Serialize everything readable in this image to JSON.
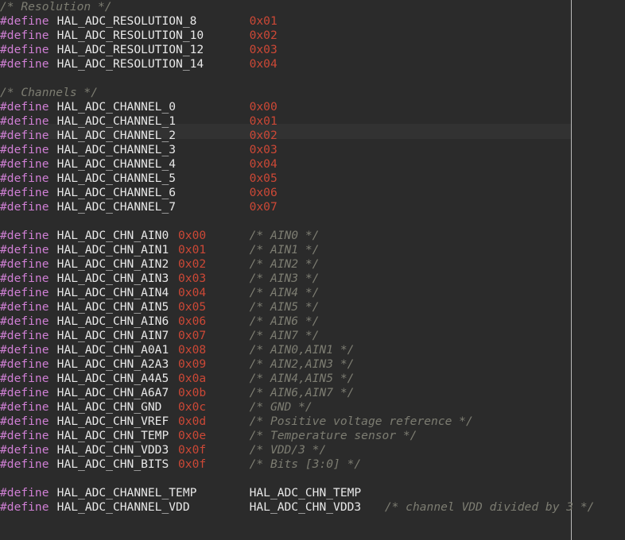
{
  "editor": {
    "language": "C",
    "font_char_width": 8.96,
    "line_height": 18,
    "colors": {
      "background": "#2b2b2b",
      "current_line": "#323232",
      "margin_ruler": "#b9b9b9",
      "directive": "#cf7fd4",
      "identifier": "#e8e8e8",
      "number": "#cc4836",
      "comment": "#7d7d72"
    },
    "margin_column": 80,
    "highlighted_line_index": 9
  },
  "lines": [
    {
      "index": 0,
      "tokens": [
        {
          "col": 0,
          "type": "comment",
          "text": "/* Resolution */"
        }
      ]
    },
    {
      "index": 1,
      "tokens": [
        {
          "col": 0,
          "type": "directive",
          "text": "#define"
        },
        {
          "col": 8,
          "type": "ident",
          "text": "HAL_ADC_RESOLUTION_8"
        },
        {
          "col": 35,
          "type": "number",
          "text": "0x01"
        }
      ]
    },
    {
      "index": 2,
      "tokens": [
        {
          "col": 0,
          "type": "directive",
          "text": "#define"
        },
        {
          "col": 8,
          "type": "ident",
          "text": "HAL_ADC_RESOLUTION_10"
        },
        {
          "col": 35,
          "type": "number",
          "text": "0x02"
        }
      ]
    },
    {
      "index": 3,
      "tokens": [
        {
          "col": 0,
          "type": "directive",
          "text": "#define"
        },
        {
          "col": 8,
          "type": "ident",
          "text": "HAL_ADC_RESOLUTION_12"
        },
        {
          "col": 35,
          "type": "number",
          "text": "0x03"
        }
      ]
    },
    {
      "index": 4,
      "tokens": [
        {
          "col": 0,
          "type": "directive",
          "text": "#define"
        },
        {
          "col": 8,
          "type": "ident",
          "text": "HAL_ADC_RESOLUTION_14"
        },
        {
          "col": 35,
          "type": "number",
          "text": "0x04"
        }
      ]
    },
    {
      "index": 5,
      "tokens": []
    },
    {
      "index": 6,
      "tokens": [
        {
          "col": 0,
          "type": "comment",
          "text": "/* Channels */"
        }
      ]
    },
    {
      "index": 7,
      "tokens": [
        {
          "col": 0,
          "type": "directive",
          "text": "#define"
        },
        {
          "col": 8,
          "type": "ident",
          "text": "HAL_ADC_CHANNEL_0"
        },
        {
          "col": 35,
          "type": "number",
          "text": "0x00"
        }
      ]
    },
    {
      "index": 8,
      "tokens": [
        {
          "col": 0,
          "type": "directive",
          "text": "#define"
        },
        {
          "col": 8,
          "type": "ident",
          "text": "HAL_ADC_CHANNEL_1"
        },
        {
          "col": 35,
          "type": "number",
          "text": "0x01"
        }
      ]
    },
    {
      "index": 9,
      "tokens": [
        {
          "col": 0,
          "type": "directive",
          "text": "#define"
        },
        {
          "col": 8,
          "type": "ident",
          "text": "HAL_ADC_CHANNEL_2"
        },
        {
          "col": 35,
          "type": "number",
          "text": "0x02"
        }
      ]
    },
    {
      "index": 10,
      "tokens": [
        {
          "col": 0,
          "type": "directive",
          "text": "#define"
        },
        {
          "col": 8,
          "type": "ident",
          "text": "HAL_ADC_CHANNEL_3"
        },
        {
          "col": 35,
          "type": "number",
          "text": "0x03"
        }
      ]
    },
    {
      "index": 11,
      "tokens": [
        {
          "col": 0,
          "type": "directive",
          "text": "#define"
        },
        {
          "col": 8,
          "type": "ident",
          "text": "HAL_ADC_CHANNEL_4"
        },
        {
          "col": 35,
          "type": "number",
          "text": "0x04"
        }
      ]
    },
    {
      "index": 12,
      "tokens": [
        {
          "col": 0,
          "type": "directive",
          "text": "#define"
        },
        {
          "col": 8,
          "type": "ident",
          "text": "HAL_ADC_CHANNEL_5"
        },
        {
          "col": 35,
          "type": "number",
          "text": "0x05"
        }
      ]
    },
    {
      "index": 13,
      "tokens": [
        {
          "col": 0,
          "type": "directive",
          "text": "#define"
        },
        {
          "col": 8,
          "type": "ident",
          "text": "HAL_ADC_CHANNEL_6"
        },
        {
          "col": 35,
          "type": "number",
          "text": "0x06"
        }
      ]
    },
    {
      "index": 14,
      "tokens": [
        {
          "col": 0,
          "type": "directive",
          "text": "#define"
        },
        {
          "col": 8,
          "type": "ident",
          "text": "HAL_ADC_CHANNEL_7"
        },
        {
          "col": 35,
          "type": "number",
          "text": "0x07"
        }
      ]
    },
    {
      "index": 15,
      "tokens": []
    },
    {
      "index": 16,
      "tokens": [
        {
          "col": 0,
          "type": "directive",
          "text": "#define"
        },
        {
          "col": 8,
          "type": "ident",
          "text": "HAL_ADC_CHN_AIN0"
        },
        {
          "col": 25,
          "type": "number",
          "text": "0x00"
        },
        {
          "col": 35,
          "type": "comment",
          "text": "/* AIN0 */"
        }
      ]
    },
    {
      "index": 17,
      "tokens": [
        {
          "col": 0,
          "type": "directive",
          "text": "#define"
        },
        {
          "col": 8,
          "type": "ident",
          "text": "HAL_ADC_CHN_AIN1"
        },
        {
          "col": 25,
          "type": "number",
          "text": "0x01"
        },
        {
          "col": 35,
          "type": "comment",
          "text": "/* AIN1 */"
        }
      ]
    },
    {
      "index": 18,
      "tokens": [
        {
          "col": 0,
          "type": "directive",
          "text": "#define"
        },
        {
          "col": 8,
          "type": "ident",
          "text": "HAL_ADC_CHN_AIN2"
        },
        {
          "col": 25,
          "type": "number",
          "text": "0x02"
        },
        {
          "col": 35,
          "type": "comment",
          "text": "/* AIN2 */"
        }
      ]
    },
    {
      "index": 19,
      "tokens": [
        {
          "col": 0,
          "type": "directive",
          "text": "#define"
        },
        {
          "col": 8,
          "type": "ident",
          "text": "HAL_ADC_CHN_AIN3"
        },
        {
          "col": 25,
          "type": "number",
          "text": "0x03"
        },
        {
          "col": 35,
          "type": "comment",
          "text": "/* AIN3 */"
        }
      ]
    },
    {
      "index": 20,
      "tokens": [
        {
          "col": 0,
          "type": "directive",
          "text": "#define"
        },
        {
          "col": 8,
          "type": "ident",
          "text": "HAL_ADC_CHN_AIN4"
        },
        {
          "col": 25,
          "type": "number",
          "text": "0x04"
        },
        {
          "col": 35,
          "type": "comment",
          "text": "/* AIN4 */"
        }
      ]
    },
    {
      "index": 21,
      "tokens": [
        {
          "col": 0,
          "type": "directive",
          "text": "#define"
        },
        {
          "col": 8,
          "type": "ident",
          "text": "HAL_ADC_CHN_AIN5"
        },
        {
          "col": 25,
          "type": "number",
          "text": "0x05"
        },
        {
          "col": 35,
          "type": "comment",
          "text": "/* AIN5 */"
        }
      ]
    },
    {
      "index": 22,
      "tokens": [
        {
          "col": 0,
          "type": "directive",
          "text": "#define"
        },
        {
          "col": 8,
          "type": "ident",
          "text": "HAL_ADC_CHN_AIN6"
        },
        {
          "col": 25,
          "type": "number",
          "text": "0x06"
        },
        {
          "col": 35,
          "type": "comment",
          "text": "/* AIN6 */"
        }
      ]
    },
    {
      "index": 23,
      "tokens": [
        {
          "col": 0,
          "type": "directive",
          "text": "#define"
        },
        {
          "col": 8,
          "type": "ident",
          "text": "HAL_ADC_CHN_AIN7"
        },
        {
          "col": 25,
          "type": "number",
          "text": "0x07"
        },
        {
          "col": 35,
          "type": "comment",
          "text": "/* AIN7 */"
        }
      ]
    },
    {
      "index": 24,
      "tokens": [
        {
          "col": 0,
          "type": "directive",
          "text": "#define"
        },
        {
          "col": 8,
          "type": "ident",
          "text": "HAL_ADC_CHN_A0A1"
        },
        {
          "col": 25,
          "type": "number",
          "text": "0x08"
        },
        {
          "col": 35,
          "type": "comment",
          "text": "/* AIN0,AIN1 */"
        }
      ]
    },
    {
      "index": 25,
      "tokens": [
        {
          "col": 0,
          "type": "directive",
          "text": "#define"
        },
        {
          "col": 8,
          "type": "ident",
          "text": "HAL_ADC_CHN_A2A3"
        },
        {
          "col": 25,
          "type": "number",
          "text": "0x09"
        },
        {
          "col": 35,
          "type": "comment",
          "text": "/* AIN2,AIN3 */"
        }
      ]
    },
    {
      "index": 26,
      "tokens": [
        {
          "col": 0,
          "type": "directive",
          "text": "#define"
        },
        {
          "col": 8,
          "type": "ident",
          "text": "HAL_ADC_CHN_A4A5"
        },
        {
          "col": 25,
          "type": "number",
          "text": "0x0a"
        },
        {
          "col": 35,
          "type": "comment",
          "text": "/* AIN4,AIN5 */"
        }
      ]
    },
    {
      "index": 27,
      "tokens": [
        {
          "col": 0,
          "type": "directive",
          "text": "#define"
        },
        {
          "col": 8,
          "type": "ident",
          "text": "HAL_ADC_CHN_A6A7"
        },
        {
          "col": 25,
          "type": "number",
          "text": "0x0b"
        },
        {
          "col": 35,
          "type": "comment",
          "text": "/* AIN6,AIN7 */"
        }
      ]
    },
    {
      "index": 28,
      "tokens": [
        {
          "col": 0,
          "type": "directive",
          "text": "#define"
        },
        {
          "col": 8,
          "type": "ident",
          "text": "HAL_ADC_CHN_GND"
        },
        {
          "col": 25,
          "type": "number",
          "text": "0x0c"
        },
        {
          "col": 35,
          "type": "comment",
          "text": "/* GND */"
        }
      ]
    },
    {
      "index": 29,
      "tokens": [
        {
          "col": 0,
          "type": "directive",
          "text": "#define"
        },
        {
          "col": 8,
          "type": "ident",
          "text": "HAL_ADC_CHN_VREF"
        },
        {
          "col": 25,
          "type": "number",
          "text": "0x0d"
        },
        {
          "col": 35,
          "type": "comment",
          "text": "/* Positive voltage reference */"
        }
      ]
    },
    {
      "index": 30,
      "tokens": [
        {
          "col": 0,
          "type": "directive",
          "text": "#define"
        },
        {
          "col": 8,
          "type": "ident",
          "text": "HAL_ADC_CHN_TEMP"
        },
        {
          "col": 25,
          "type": "number",
          "text": "0x0e"
        },
        {
          "col": 35,
          "type": "comment",
          "text": "/* Temperature sensor */"
        }
      ]
    },
    {
      "index": 31,
      "tokens": [
        {
          "col": 0,
          "type": "directive",
          "text": "#define"
        },
        {
          "col": 8,
          "type": "ident",
          "text": "HAL_ADC_CHN_VDD3"
        },
        {
          "col": 25,
          "type": "number",
          "text": "0x0f"
        },
        {
          "col": 35,
          "type": "comment",
          "text": "/* VDD/3 */"
        }
      ]
    },
    {
      "index": 32,
      "tokens": [
        {
          "col": 0,
          "type": "directive",
          "text": "#define"
        },
        {
          "col": 8,
          "type": "ident",
          "text": "HAL_ADC_CHN_BITS"
        },
        {
          "col": 25,
          "type": "number",
          "text": "0x0f"
        },
        {
          "col": 35,
          "type": "comment",
          "text": "/* Bits [3:0] */"
        }
      ]
    },
    {
      "index": 33,
      "tokens": []
    },
    {
      "index": 34,
      "tokens": [
        {
          "col": 0,
          "type": "directive",
          "text": "#define"
        },
        {
          "col": 8,
          "type": "ident",
          "text": "HAL_ADC_CHANNEL_TEMP"
        },
        {
          "col": 35,
          "type": "ident",
          "text": "HAL_ADC_CHN_TEMP"
        }
      ]
    },
    {
      "index": 35,
      "tokens": [
        {
          "col": 0,
          "type": "directive",
          "text": "#define"
        },
        {
          "col": 8,
          "type": "ident",
          "text": "HAL_ADC_CHANNEL_VDD"
        },
        {
          "col": 35,
          "type": "ident",
          "text": "HAL_ADC_CHN_VDD3"
        },
        {
          "col": 54,
          "type": "comment",
          "text": "/* channel VDD divided by 3 */"
        }
      ]
    }
  ]
}
